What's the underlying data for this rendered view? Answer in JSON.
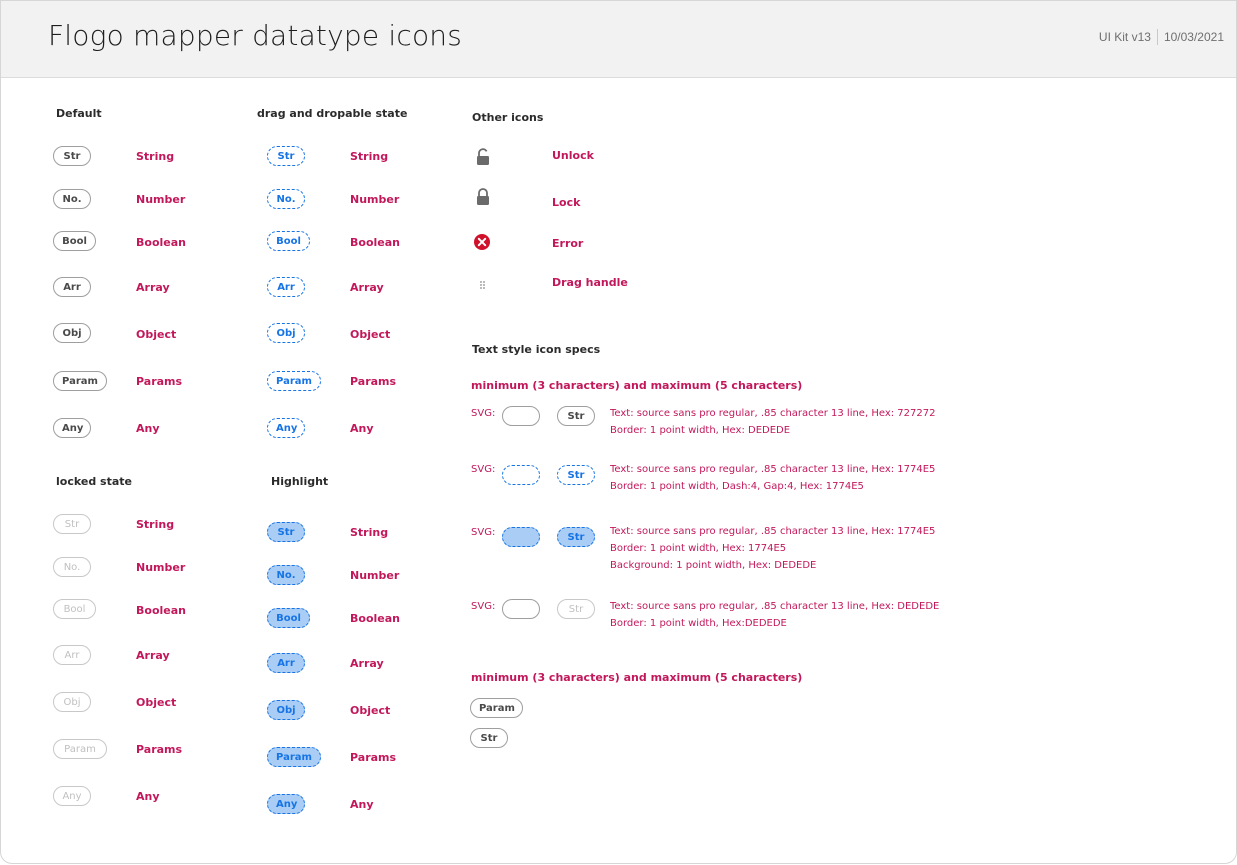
{
  "header": {
    "title": "Flogo mapper datatype icons",
    "kit": "UI Kit v13",
    "date": "10/03/2021"
  },
  "sections": {
    "default": "Default",
    "drag": "drag and dropable state",
    "locked": "locked state",
    "highlight": "Highlight",
    "other": "Other icons",
    "text_spec": "Text style icon specs"
  },
  "types": [
    {
      "abbr": "Str",
      "name": "String"
    },
    {
      "abbr": "No.",
      "name": "Number"
    },
    {
      "abbr": "Bool",
      "name": "Boolean"
    },
    {
      "abbr": "Arr",
      "name": "Array"
    },
    {
      "abbr": "Obj",
      "name": "Object"
    },
    {
      "abbr": "Param",
      "name": "Params"
    },
    {
      "abbr": "Any",
      "name": "Any"
    }
  ],
  "other_icons": [
    {
      "name": "Unlock",
      "icon": "unlock-icon"
    },
    {
      "name": "Lock",
      "icon": "lock-icon"
    },
    {
      "name": "Error",
      "icon": "error-icon"
    },
    {
      "name": "Drag handle",
      "icon": "drag-handle-icon"
    }
  ],
  "spec": {
    "range_heading": "minimum (3 characters) and maximum (5 characters)",
    "svg_label": "SVG:",
    "sample": "Str",
    "rows": [
      {
        "line1": "Text: source sans pro regular, .85 character 13 line, Hex: 727272",
        "line2": "Border: 1 point width, Hex: DEDEDE",
        "line3": ""
      },
      {
        "line1": "Text: source sans pro regular, .85 character 13 line, Hex: 1774E5",
        "line2": "Border: 1 point width, Dash:4, Gap:4, Hex: 1774E5",
        "line3": ""
      },
      {
        "line1": "Text: source sans pro regular, .85 character 13 line, Hex: 1774E5",
        "line2": "Border: 1 point width, Hex: 1774E5",
        "line3": "Background: 1 point width, Hex: DEDEDE"
      },
      {
        "line1": "Text: source sans pro regular, .85 character 13 line, Hex: DEDEDE",
        "line2": "Border: 1 point width, Hex:DEDEDE",
        "line3": ""
      }
    ],
    "range_heading2": "minimum (3 characters) and maximum (5 characters)",
    "example_param": "Param",
    "example_str": "Str"
  },
  "colors": {
    "label": "#c2185b",
    "blue": "#1774e5",
    "highlight_bg": "#a9cdf5",
    "border_grey": "#dedede"
  }
}
